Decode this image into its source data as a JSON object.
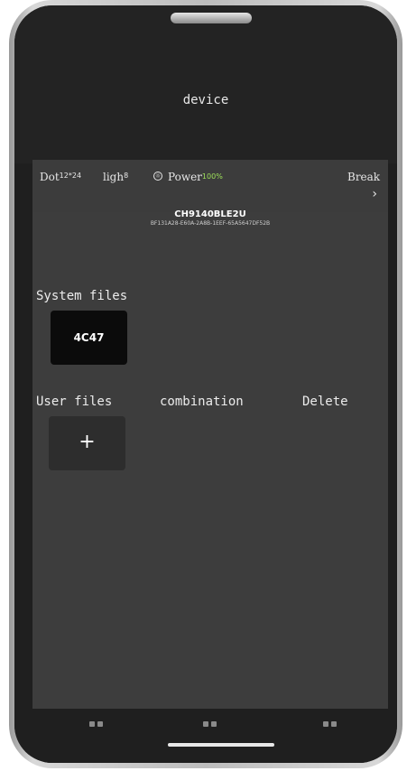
{
  "header": {
    "title": "device"
  },
  "status_bar": {
    "dot_label": "Dot",
    "dot_value": "12*24",
    "light_label": "ligh",
    "light_value": "8",
    "power_label": "Power",
    "power_value": "100%",
    "break_label": "Break",
    "chevron": "›"
  },
  "device": {
    "name": "CH9140BLE2U",
    "uuid": "BF131A28-E60A-2A8B-1EEF-65A5647DF52B"
  },
  "system_files": {
    "label": "System files",
    "items": [
      "4C47"
    ]
  },
  "user_files": {
    "label": "User files",
    "combination_label": "combination",
    "delete_label": "Delete",
    "add_button": "+"
  },
  "nav": {
    "icons": [
      "nav-icon-left",
      "nav-icon-center",
      "nav-icon-right"
    ]
  }
}
